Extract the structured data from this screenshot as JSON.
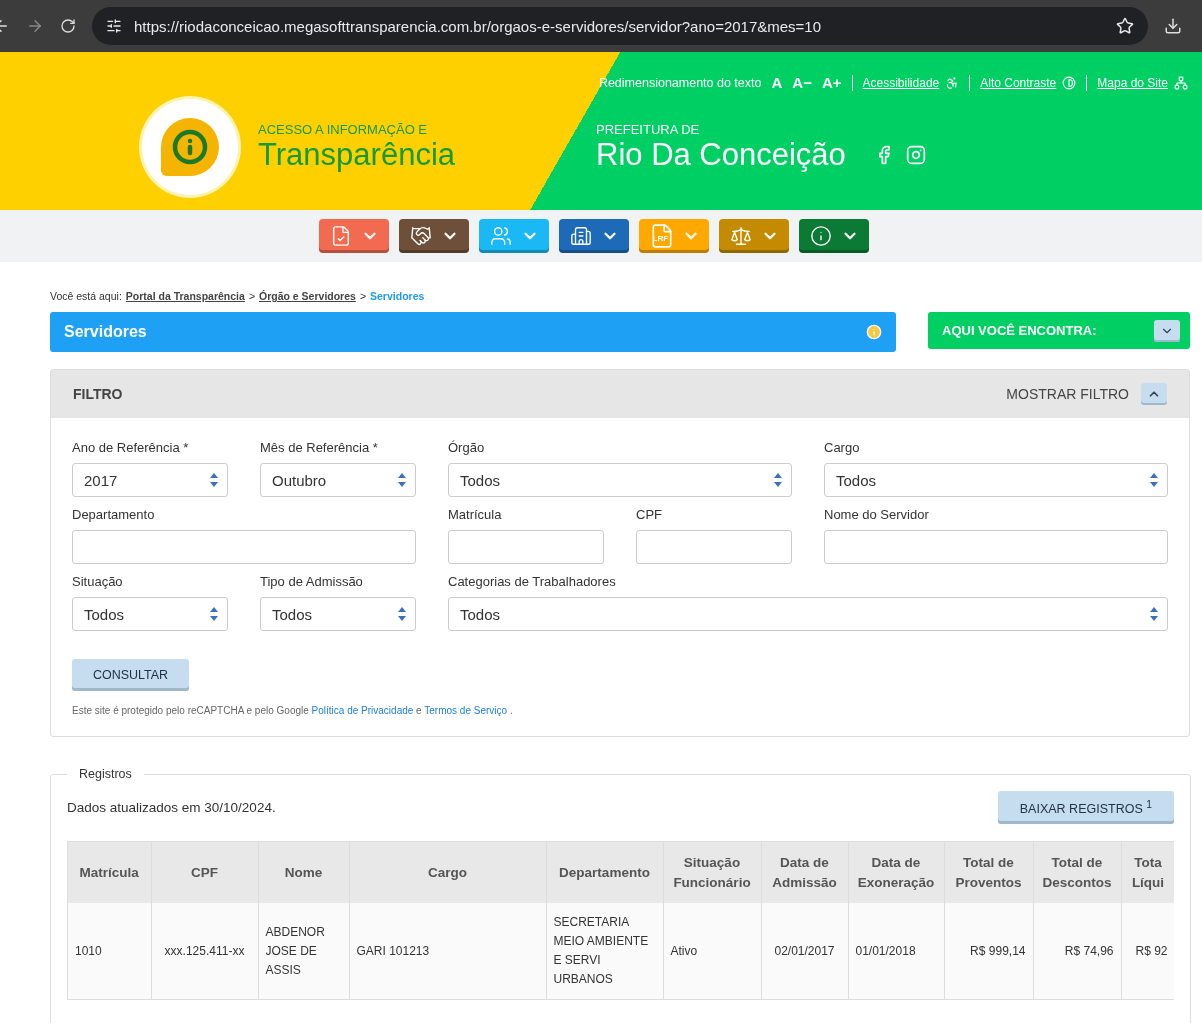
{
  "browser": {
    "url": "https://riodaconceicao.megasofttransparencia.com.br/orgaos-e-servidores/servidor?ano=2017&mes=10"
  },
  "header": {
    "access_links": [
      {
        "kind": "plain",
        "label": "Redimensionamento do texto"
      },
      {
        "kind": "size",
        "label": "A"
      },
      {
        "kind": "size",
        "label": "A−"
      },
      {
        "kind": "size",
        "label": "A+"
      },
      {
        "kind": "link",
        "label": "Acessibilidade"
      },
      {
        "kind": "link",
        "label": "Alto Contraste"
      },
      {
        "kind": "link",
        "label": "Mapa do Site"
      }
    ],
    "brand_small": "ACESSO A INFORMAÇÃO E",
    "brand_large": "Transparência",
    "city_small": "PREFEITURA DE",
    "city_large": "Rio Da Conceição"
  },
  "nav": [
    {
      "color": "#f26a50"
    },
    {
      "color": "#6e4f3a"
    },
    {
      "color": "#1ab8f5"
    },
    {
      "color": "#1c6ab8"
    },
    {
      "color": "#ffa800",
      "icon_text": "LRF"
    },
    {
      "color": "#c48a00"
    },
    {
      "color": "#0a7a34"
    }
  ],
  "breadcrumb": {
    "prefix": "Você está aqui:",
    "separators": [
      ">",
      ">"
    ],
    "items": [
      {
        "label": "Portal da Transparência",
        "selected": false
      },
      {
        "label": "Órgão e Servidores",
        "selected": false
      },
      {
        "label": "Servidores",
        "selected": true
      }
    ]
  },
  "title": "Servidores",
  "side_box": "AQUI VOCÊ ENCONTRA:",
  "filter": {
    "title": "FILTRO",
    "toggle": "MOSTRAR FILTRO",
    "fields": [
      {
        "label": "Ano de Referência *",
        "kind": "select",
        "value": "2017"
      },
      {
        "label": "Mês de Referência *",
        "kind": "select",
        "value": "Outubro"
      },
      {
        "label": "Órgão",
        "kind": "select",
        "value": "Todos"
      },
      {
        "label": "Cargo",
        "kind": "select",
        "value": "Todos"
      },
      {
        "label": "Departamento",
        "kind": "text"
      },
      {
        "label": "Matrícula",
        "kind": "text"
      },
      {
        "label": "CPF",
        "kind": "text"
      },
      {
        "label": "Nome do Servidor",
        "kind": "text"
      },
      {
        "label": "Situação",
        "kind": "select",
        "value": "Todos"
      },
      {
        "label": "Tipo de Admissão",
        "kind": "select",
        "value": "Todos"
      },
      {
        "label": "Categorias de Trabalhadores",
        "kind": "select",
        "value": "Todos"
      }
    ],
    "submit": "CONSULTAR",
    "notice": {
      "before": "Este site é protegido pelo reCAPTCHA e pelo Google",
      "link1": "Política de Privacidade",
      "middle": "e",
      "link2": "Termos de Serviço",
      "after": "."
    }
  },
  "records": {
    "legend": "Registros",
    "updated": "Dados atualizados em 30/10/2024.",
    "download": "BAIXAR REGISTROS $^{1}$",
    "columns": [
      "Matrícula",
      "CPF",
      "Nome",
      "Cargo",
      "Departamento",
      "Situação Funcionário",
      "Data de Admissão",
      "Data de Exoneração",
      "Total de Proventos",
      "Total de Descontos",
      "Tota Líqui"
    ],
    "rows": [
      [
        "1010",
        "xxx.125.411-xx",
        "ABDENOR JOSE DE ASSIS",
        "GARI 101213",
        "SECRETARIA MEIO AMBIENTE E SERVI URBANOS",
        "Ativo",
        "02/01/2017",
        "01/01/2018",
        "R$ 999,14",
        "R$ 74,96",
        "R$ 92"
      ]
    ]
  }
}
